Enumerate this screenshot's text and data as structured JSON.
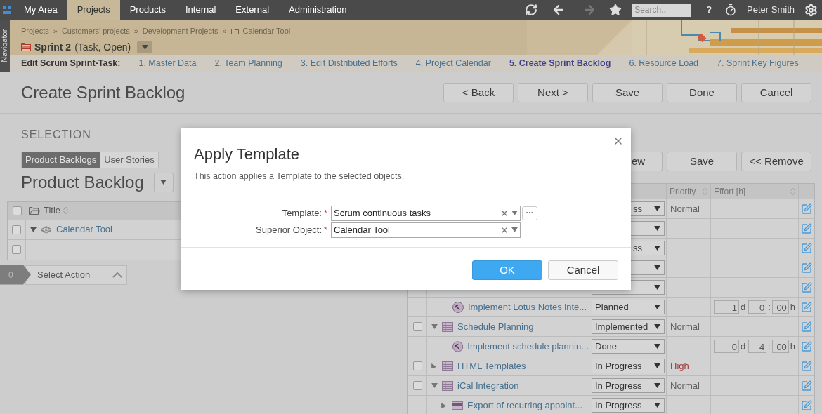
{
  "nav": {
    "items": [
      {
        "label": "My Area",
        "selected": false
      },
      {
        "label": "Projects",
        "selected": true
      },
      {
        "label": "Products",
        "selected": false
      },
      {
        "label": "Internal",
        "selected": false
      },
      {
        "label": "External",
        "selected": false
      },
      {
        "label": "Administration",
        "selected": false
      }
    ],
    "search": {
      "placeholder": "Search..."
    },
    "help": "?",
    "user": "Peter Smith"
  },
  "navigator": "Navigator",
  "breadcrumb": {
    "separator": "»",
    "items": [
      "Projects",
      "Customers' projects",
      "Development Projects",
      "Calendar Tool"
    ]
  },
  "object": {
    "name": "Sprint 2",
    "meta": "(Task, Open)"
  },
  "steps": {
    "label": "Edit Scrum Sprint-Task:",
    "items": [
      {
        "label": "1. Master Data",
        "selected": false
      },
      {
        "label": "2. Team Planning",
        "selected": false
      },
      {
        "label": "3. Edit Distributed Efforts",
        "selected": false
      },
      {
        "label": "4. Project Calendar",
        "selected": false
      },
      {
        "label": "5. Create Sprint Backlog",
        "selected": true
      },
      {
        "label": "6. Resource Load",
        "selected": false
      },
      {
        "label": "7. Sprint Key Figures",
        "selected": false
      }
    ]
  },
  "page_title": "Create Sprint Backlog",
  "toolbar": [
    "< Back",
    "Next >",
    "Save",
    "Done",
    "Cancel"
  ],
  "selection": {
    "heading": "SELECTION",
    "tabs": [
      {
        "label": "Product Backlogs",
        "selected": true
      },
      {
        "label": "User Stories",
        "selected": false
      }
    ],
    "title": "Product Backlog",
    "column": "Title",
    "header_checked": false,
    "rows": [
      {
        "title": "Calendar Tool",
        "checked": false,
        "expanded": true
      },
      {
        "checked": false
      }
    ],
    "action_bar": {
      "count": "0",
      "label": "Select Action"
    }
  },
  "backlog": {
    "buttons": [
      "ew",
      "Save",
      "<< Remove"
    ],
    "columns": [
      "Priority",
      "Effort [h]"
    ],
    "rows": [
      {
        "kind": "covered",
        "status": "ss",
        "priority": "Normal",
        "color": "#5f5f5f"
      },
      {
        "kind": "covered"
      },
      {
        "kind": "covered",
        "status": "ss"
      },
      {
        "kind": "covered"
      },
      {
        "kind": "covered"
      },
      {
        "kind": "task",
        "title": "Implement Lotus Notes inte...",
        "status": "Planned",
        "effort": {
          "days": "1",
          "day_unit": "d",
          "hours": "0",
          "separator": ":",
          "minutes": "00",
          "hour_unit": "h"
        }
      },
      {
        "kind": "story",
        "checked": false,
        "expanded": true,
        "title": "Schedule Planning",
        "status": "Implemented",
        "priority": "Normal",
        "color": "#5f5f5f"
      },
      {
        "kind": "task",
        "title": "Implement schedule plannin...",
        "status": "Done",
        "effort": {
          "days": "0",
          "day_unit": "d",
          "hours": "4",
          "separator": ":",
          "minutes": "00",
          "hour_unit": "h"
        }
      },
      {
        "kind": "story",
        "checked": false,
        "expanded": false,
        "title": "HTML Templates",
        "status": "In Progress",
        "priority": "High",
        "color": "#a33a3a"
      },
      {
        "kind": "story",
        "checked": false,
        "expanded": true,
        "title": "iCal Integration",
        "status": "In Progress",
        "priority": "Normal",
        "color": "#5f5f5f"
      },
      {
        "kind": "feature",
        "expanded": false,
        "title": "Export of recurring appoint...",
        "status": "In Progress"
      }
    ]
  },
  "dialog": {
    "title": "Apply Template",
    "description": "This action applies a Template to the selected objects.",
    "required_mark": "*",
    "fields": [
      {
        "label": "Template:",
        "required": true,
        "value": "Scrum continuous tasks",
        "browse": "···"
      },
      {
        "label": "Superior Object:",
        "required": true,
        "value": "Calendar Tool"
      }
    ],
    "buttons": [
      {
        "label": "OK",
        "kind": "primary"
      },
      {
        "label": "Cancel",
        "kind": "secondary"
      }
    ]
  }
}
